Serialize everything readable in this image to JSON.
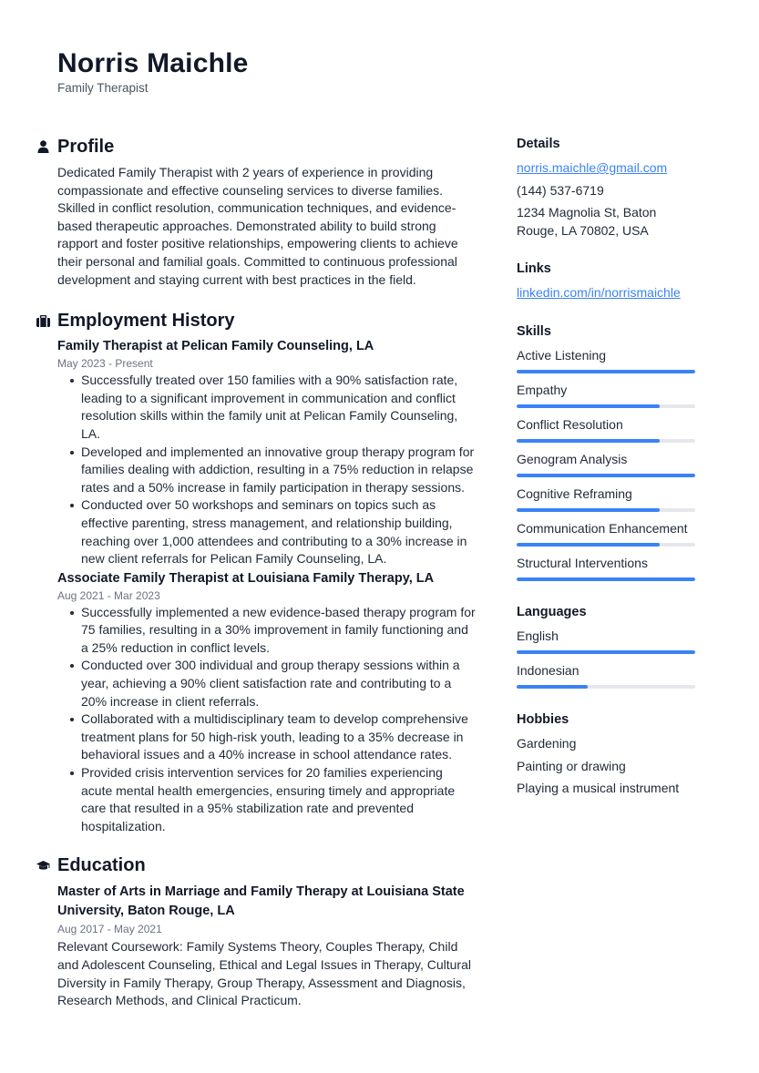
{
  "header": {
    "name": "Norris Maichle",
    "title": "Family Therapist"
  },
  "profile": {
    "heading": "Profile",
    "icon": "person-icon",
    "text": "Dedicated Family Therapist with 2 years of experience in providing compassionate and effective counseling services to diverse families. Skilled in conflict resolution, communication techniques, and evidence-based therapeutic approaches. Demonstrated ability to build strong rapport and foster positive relationships, empowering clients to achieve their personal and familial goals. Committed to continuous professional development and staying current with best practices in the field."
  },
  "employment": {
    "heading": "Employment History",
    "icon": "briefcase-icon",
    "jobs": [
      {
        "title": "Family Therapist at Pelican Family Counseling, LA",
        "dates": "May 2023 - Present",
        "bullets": [
          "Successfully treated over 150 families with a 90% satisfaction rate, leading to a significant improvement in communication and conflict resolution skills within the family unit at Pelican Family Counseling, LA.",
          "Developed and implemented an innovative group therapy program for families dealing with addiction, resulting in a 75% reduction in relapse rates and a 50% increase in family participation in therapy sessions.",
          "Conducted over 50 workshops and seminars on topics such as effective parenting, stress management, and relationship building, reaching over 1,000 attendees and contributing to a 30% increase in new client referrals for Pelican Family Counseling, LA."
        ]
      },
      {
        "title": "Associate Family Therapist at Louisiana Family Therapy, LA",
        "dates": "Aug 2021 - Mar 2023",
        "bullets": [
          "Successfully implemented a new evidence-based therapy program for 75 families, resulting in a 30% improvement in family functioning and a 25% reduction in conflict levels.",
          "Conducted over 300 individual and group therapy sessions within a year, achieving a 90% client satisfaction rate and contributing to a 20% increase in client referrals.",
          "Collaborated with a multidisciplinary team to develop comprehensive treatment plans for 50 high-risk youth, leading to a 35% decrease in behavioral issues and a 40% increase in school attendance rates.",
          "Provided crisis intervention services for 20 families experiencing acute mental health emergencies, ensuring timely and appropriate care that resulted in a 95% stabilization rate and prevented hospitalization."
        ]
      }
    ]
  },
  "education": {
    "heading": "Education",
    "icon": "graduation-cap-icon",
    "items": [
      {
        "title": "Master of Arts in Marriage and Family Therapy at Louisiana State University, Baton Rouge, LA",
        "dates": "Aug 2017 - May 2021",
        "description": "Relevant Coursework: Family Systems Theory, Couples Therapy, Child and Adolescent Counseling, Ethical and Legal Issues in Therapy, Cultural Diversity in Family Therapy, Group Therapy, Assessment and Diagnosis, Research Methods, and Clinical Practicum."
      }
    ]
  },
  "details": {
    "heading": "Details",
    "email": "norris.maichle@gmail.com",
    "phone": "(144) 537-6719",
    "address": "1234 Magnolia St, Baton Rouge, LA 70802, USA"
  },
  "links": {
    "heading": "Links",
    "items": [
      "linkedin.com/in/norrismaichle"
    ]
  },
  "skills": {
    "heading": "Skills",
    "items": [
      {
        "label": "Active Listening",
        "level": 1.0
      },
      {
        "label": "Empathy",
        "level": 0.8
      },
      {
        "label": "Conflict Resolution",
        "level": 0.8
      },
      {
        "label": "Genogram Analysis",
        "level": 1.0
      },
      {
        "label": "Cognitive Reframing",
        "level": 0.8
      },
      {
        "label": "Communication Enhancement",
        "level": 0.8
      },
      {
        "label": "Structural Interventions",
        "level": 1.0
      }
    ]
  },
  "languages": {
    "heading": "Languages",
    "items": [
      {
        "label": "English",
        "level": 1.0
      },
      {
        "label": "Indonesian",
        "level": 0.4
      }
    ]
  },
  "hobbies": {
    "heading": "Hobbies",
    "items": [
      "Gardening",
      "Painting or drawing",
      "Playing a musical instrument"
    ]
  },
  "colors": {
    "accent": "#3b82f6",
    "bar_track": "#e5e7eb",
    "text": "#1f2937",
    "muted": "#6b7280"
  }
}
